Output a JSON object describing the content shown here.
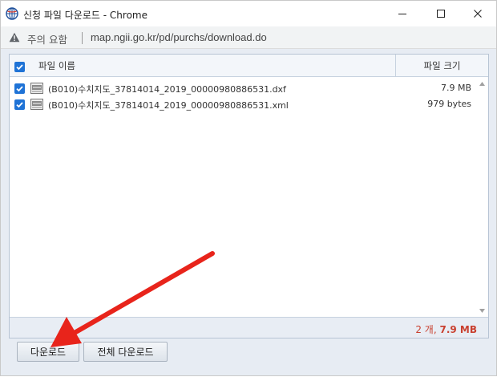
{
  "window": {
    "title": "신청 파일 다운로드 - Chrome",
    "icons": {
      "app": "globe-icon",
      "minimize": "minimize-icon",
      "maximize": "maximize-icon",
      "close": "close-icon"
    }
  },
  "address_bar": {
    "warning_icon": "warning-triangle-icon",
    "warning_label": "주의 요함",
    "url": "map.ngii.go.kr/pd/purchs/download.do"
  },
  "file_grid": {
    "columns": {
      "name": "파일 이름",
      "size": "파일 크기"
    },
    "select_all_checked": true,
    "rows": [
      {
        "checked": true,
        "icon": "file-icon",
        "name": "(B010)수치지도_37814014_2019_00000980886531.dxf",
        "size": "7.9 MB"
      },
      {
        "checked": true,
        "icon": "file-icon",
        "name": "(B010)수치지도_37814014_2019_00000980886531.xml",
        "size": "979 bytes"
      }
    ],
    "summary": {
      "count": "2 개,",
      "total": "7.9 MB"
    },
    "scrollbar_icons": {
      "up": "scroll-up-icon",
      "down": "scroll-down-icon"
    }
  },
  "buttons": {
    "download": "다운로드",
    "download_all": "전체 다운로드"
  },
  "annotation": {
    "arrow_color": "#e8241b"
  },
  "colors": {
    "accent": "#1f73d6",
    "summary": "#c9402f"
  }
}
